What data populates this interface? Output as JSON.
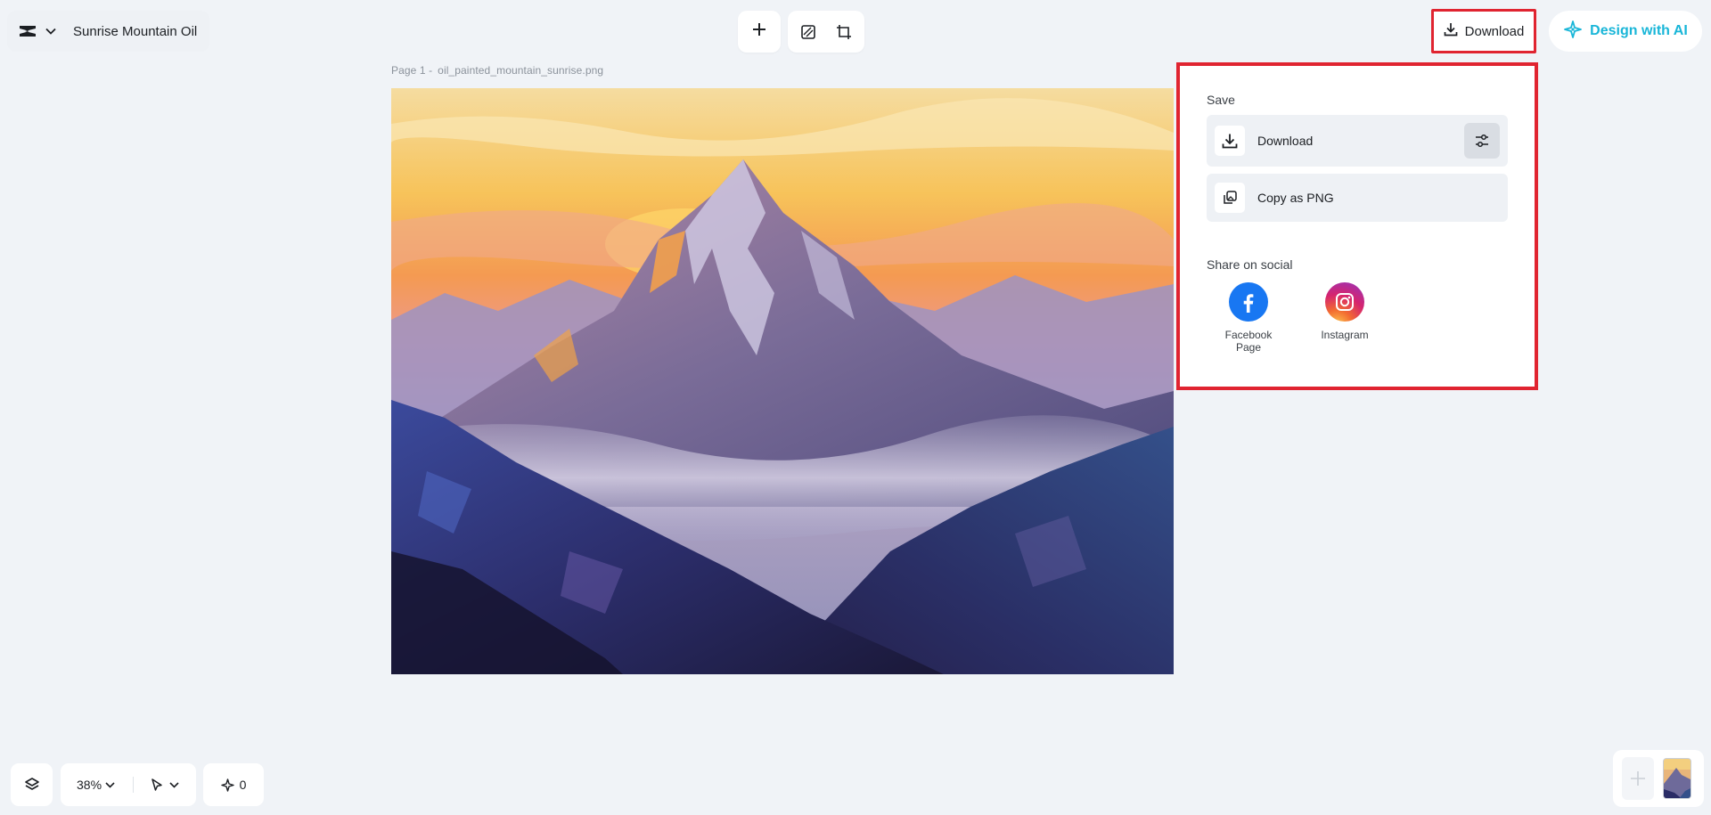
{
  "header": {
    "project_title": "Sunrise Mountain Oil",
    "download_label": "Download",
    "design_ai_label": "Design with AI"
  },
  "canvas": {
    "page_label": "Page 1 -",
    "file_name": "oil_painted_mountain_sunrise.png"
  },
  "download_panel": {
    "save_heading": "Save",
    "download_label": "Download",
    "copy_label": "Copy as PNG",
    "share_heading": "Share on social",
    "social": [
      {
        "label": "Facebook Page",
        "icon": "facebook-icon"
      },
      {
        "label": "Instagram",
        "icon": "instagram-icon"
      }
    ]
  },
  "bottom_toolbar": {
    "zoom": "38%",
    "ai_count": "0"
  },
  "colors": {
    "highlight_red": "#e02430",
    "ai_accent": "#19b6d8",
    "facebook_blue": "#1877f2",
    "background": "#f0f3f7"
  }
}
